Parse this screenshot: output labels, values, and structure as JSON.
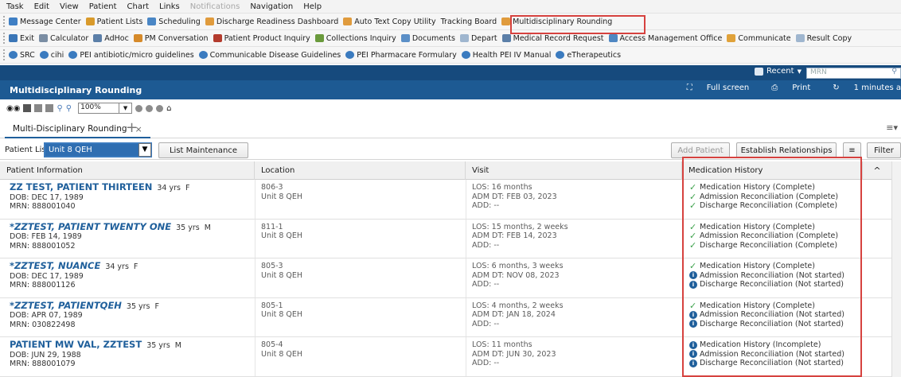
{
  "menu": [
    {
      "label": "Task",
      "disabled": false
    },
    {
      "label": "Edit",
      "disabled": false
    },
    {
      "label": "View",
      "disabled": false
    },
    {
      "label": "Patient",
      "disabled": false
    },
    {
      "label": "Chart",
      "disabled": false
    },
    {
      "label": "Links",
      "disabled": false
    },
    {
      "label": "Notifications",
      "disabled": true
    },
    {
      "label": "Navigation",
      "disabled": false
    },
    {
      "label": "Help",
      "disabled": false
    }
  ],
  "toolbar1": [
    {
      "label": "Message Center",
      "icon": "message-icon",
      "color": "#3f7fc4"
    },
    {
      "label": "Patient Lists",
      "icon": "person-icon",
      "color": "#d99a2b"
    },
    {
      "label": "Scheduling",
      "icon": "calendar-icon",
      "color": "#4a86c5"
    },
    {
      "label": "Discharge Readiness Dashboard",
      "icon": "dashboard-icon",
      "color": "#e09b3d"
    },
    {
      "label": "Auto Text Copy Utility",
      "icon": "dashboard-icon",
      "color": "#e09b3d"
    },
    {
      "label": "Tracking Board",
      "icon": "",
      "color": ""
    },
    {
      "label": "Multidisciplinary Rounding",
      "icon": "dashboard-icon",
      "color": "#e09b3d"
    }
  ],
  "toolbar2": [
    {
      "label": "Exit",
      "icon": "exit-icon",
      "color": "#3b76b7"
    },
    {
      "label": "Calculator",
      "icon": "calculator-icon",
      "color": "#7a8da3"
    },
    {
      "label": "AdHoc",
      "icon": "adhoc-icon",
      "color": "#5b7fa8"
    },
    {
      "label": "PM Conversation",
      "icon": "person-icon",
      "color": "#d68a2a"
    },
    {
      "label": "Patient Product Inquiry",
      "icon": "inquiry-icon",
      "color": "#b33b2d"
    },
    {
      "label": "Collections Inquiry",
      "icon": "collections-icon",
      "color": "#6a9a3c"
    },
    {
      "label": "Documents",
      "icon": "documents-icon",
      "color": "#5b8fc7"
    },
    {
      "label": "Depart",
      "icon": "depart-icon",
      "color": "#9fb6cf"
    },
    {
      "label": "Medical Record Request",
      "icon": "record-icon",
      "color": "#5b7fa8"
    },
    {
      "label": "Access Management Office",
      "icon": "office-icon",
      "color": "#4f87c2"
    },
    {
      "label": "Communicate",
      "icon": "communicate-icon",
      "color": "#e0a23a"
    },
    {
      "label": "Result Copy",
      "icon": "result-copy-icon",
      "color": "#9fb6cf"
    }
  ],
  "toolbar3": [
    {
      "label": "SRC"
    },
    {
      "label": "cihi"
    },
    {
      "label": "PEI antibiotic/micro guidelines"
    },
    {
      "label": "Communicable Disease Guidelines"
    },
    {
      "label": "PEI Pharmacare Formulary"
    },
    {
      "label": "Health PEI IV Manual"
    },
    {
      "label": "eTherapeutics"
    }
  ],
  "header": {
    "recent": "Recent",
    "mrn_placeholder": "MRN",
    "title": "Multidisciplinary Rounding",
    "full_screen": "Full screen",
    "print": "Print",
    "refresh": "1 minutes a"
  },
  "zoom": "100%",
  "tab": {
    "label": "Multi-Disciplinary Rounding",
    "close": "×",
    "add": "+"
  },
  "filters": {
    "patient_list_label": "Patient List",
    "patient_list_value": "Unit 8 QEH",
    "list_maintenance": "List Maintenance",
    "add_patient": "Add Patient",
    "establish_relationships": "Establish Relationships",
    "filter": "Filter"
  },
  "columns": {
    "patient": "Patient Information",
    "location": "Location",
    "visit": "Visit",
    "medication": "Medication History"
  },
  "patients": [
    {
      "name": "ZZ TEST, PATIENT THIRTEEN",
      "italic": false,
      "age": "34 yrs",
      "sex": "F",
      "dob": "DOB: DEC 17, 1989",
      "mrn": "MRN: 888001040",
      "room": "806-3",
      "unit": "Unit 8 QEH",
      "los": "LOS: 16 months",
      "adm": "ADM DT: FEB 03, 2023",
      "add": "ADD: --",
      "meds": [
        {
          "status": "complete",
          "text": "Medication History (Complete)"
        },
        {
          "status": "complete",
          "text": "Admission Reconciliation (Complete)"
        },
        {
          "status": "complete",
          "text": "Discharge Reconciliation (Complete)"
        }
      ]
    },
    {
      "name": "*ZZTEST, PATIENT TWENTY ONE",
      "italic": true,
      "age": "35 yrs",
      "sex": "M",
      "dob": "DOB: FEB 14, 1989",
      "mrn": "MRN: 888001052",
      "room": "811-1",
      "unit": "Unit 8 QEH",
      "los": "LOS: 15 months, 2 weeks",
      "adm": "ADM DT: FEB 14, 2023",
      "add": "ADD: --",
      "meds": [
        {
          "status": "complete",
          "text": "Medication History (Complete)"
        },
        {
          "status": "complete",
          "text": "Admission Reconciliation (Complete)"
        },
        {
          "status": "complete",
          "text": "Discharge Reconciliation (Complete)"
        }
      ]
    },
    {
      "name": "*ZZTEST, NUANCE",
      "italic": true,
      "age": "34 yrs",
      "sex": "F",
      "dob": "DOB: DEC 17, 1989",
      "mrn": "MRN: 888001126",
      "room": "805-3",
      "unit": "Unit 8 QEH",
      "los": "LOS: 6 months, 3 weeks",
      "adm": "ADM DT: NOV 08, 2023",
      "add": "ADD: --",
      "meds": [
        {
          "status": "complete",
          "text": "Medication History (Complete)"
        },
        {
          "status": "pending",
          "text": "Admission Reconciliation (Not started)"
        },
        {
          "status": "pending",
          "text": "Discharge Reconciliation (Not started)"
        }
      ]
    },
    {
      "name": "*ZZTEST, PATIENTQEH",
      "italic": true,
      "age": "35 yrs",
      "sex": "F",
      "dob": "DOB: APR 07, 1989",
      "mrn": "MRN: 030822498",
      "room": "805-1",
      "unit": "Unit 8 QEH",
      "los": "LOS: 4 months, 2 weeks",
      "adm": "ADM DT: JAN 18, 2024",
      "add": "ADD: --",
      "meds": [
        {
          "status": "complete",
          "text": "Medication History (Complete)"
        },
        {
          "status": "pending",
          "text": "Admission Reconciliation (Not started)"
        },
        {
          "status": "pending",
          "text": "Discharge Reconciliation (Not started)"
        }
      ]
    },
    {
      "name": "PATIENT MW VAL, ZZTEST",
      "italic": false,
      "age": "35 yrs",
      "sex": "M",
      "dob": "DOB: JUN 29, 1988",
      "mrn": "MRN: 888001079",
      "room": "805-4",
      "unit": "Unit 8 QEH",
      "los": "LOS: 11 months",
      "adm": "ADM DT: JUN 30, 2023",
      "add": "ADD: --",
      "meds": [
        {
          "status": "pending",
          "text": "Medication History (Incomplete)"
        },
        {
          "status": "pending",
          "text": "Admission Reconciliation (Not started)"
        },
        {
          "status": "pending",
          "text": "Discharge Reconciliation (Not started)"
        }
      ]
    }
  ]
}
